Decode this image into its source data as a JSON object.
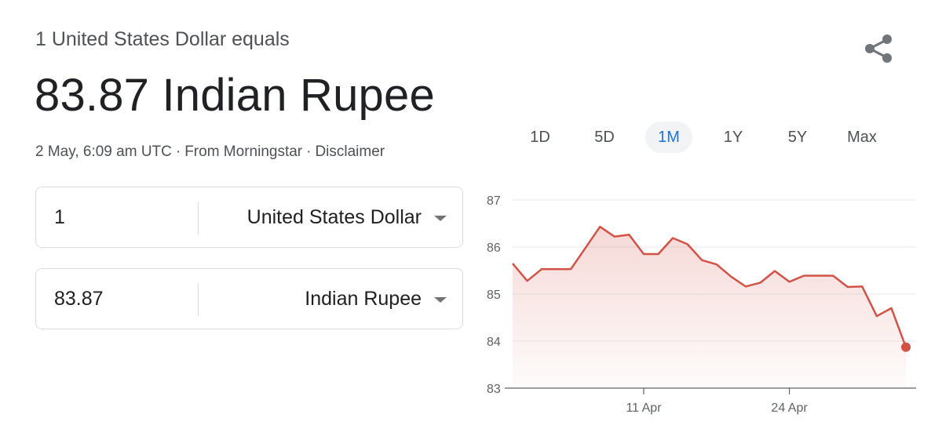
{
  "header": {
    "subtitle": "1 United States Dollar equals",
    "result": "83.87 Indian Rupee",
    "timestamp": "2 May, 6:09 am UTC",
    "source": "From Morningstar",
    "disclaimer": "Disclaimer",
    "separator": "·"
  },
  "converter": {
    "from": {
      "amount": "1",
      "currency": "United States Dollar"
    },
    "to": {
      "amount": "83.87",
      "currency": "Indian Rupee"
    }
  },
  "tabs": [
    {
      "label": "1D",
      "active": false
    },
    {
      "label": "5D",
      "active": false
    },
    {
      "label": "1M",
      "active": true
    },
    {
      "label": "1Y",
      "active": false
    },
    {
      "label": "5Y",
      "active": false
    },
    {
      "label": "Max",
      "active": false
    }
  ],
  "colors": {
    "line": "#d35246",
    "accent": "#1a73e8",
    "grid": "#e8eaed",
    "axis": "#5f6368"
  },
  "icons": {
    "share": "share-icon",
    "dropdown": "chevron-down-icon"
  },
  "chart_data": {
    "type": "area",
    "y_ticks": [
      83,
      84,
      85,
      86,
      87
    ],
    "ylim": [
      83,
      87
    ],
    "x_ticks": [
      {
        "label": "11 Apr",
        "x": 9
      },
      {
        "label": "24 Apr",
        "x": 19
      }
    ],
    "xlim": [
      0,
      27.7
    ],
    "grid": true,
    "values": [
      [
        0,
        85.65
      ],
      [
        1,
        85.28
      ],
      [
        2,
        85.53
      ],
      [
        3,
        85.53
      ],
      [
        4,
        85.53
      ],
      [
        5,
        85.98
      ],
      [
        6,
        86.43
      ],
      [
        7,
        86.22
      ],
      [
        8,
        86.26
      ],
      [
        9,
        85.85
      ],
      [
        10,
        85.85
      ],
      [
        11,
        86.19
      ],
      [
        12,
        86.06
      ],
      [
        13,
        85.72
      ],
      [
        14,
        85.63
      ],
      [
        15,
        85.37
      ],
      [
        16,
        85.16
      ],
      [
        17,
        85.24
      ],
      [
        18,
        85.49
      ],
      [
        19,
        85.26
      ],
      [
        20,
        85.39
      ],
      [
        21,
        85.39
      ],
      [
        22,
        85.39
      ],
      [
        23,
        85.15
      ],
      [
        24,
        85.16
      ],
      [
        25,
        84.53
      ],
      [
        26,
        84.7
      ],
      [
        27,
        83.87
      ]
    ]
  }
}
